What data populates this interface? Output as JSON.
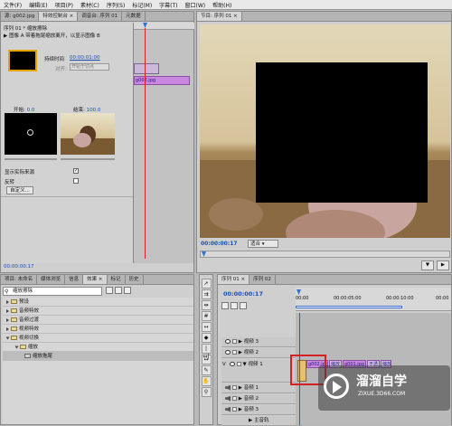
{
  "menubar": [
    "文件(F)",
    "编辑(E)",
    "项目(P)",
    "素材(C)",
    "序列(S)",
    "标记(M)",
    "字幕(T)",
    "窗口(W)",
    "帮助(H)"
  ],
  "effect_controls": {
    "tabs": [
      "源: g002.jpg",
      "特效控制台 ×",
      "调音台: 序列 01",
      "元数据"
    ],
    "sequence": "序列 01 * 缩放擦除",
    "clip": "g002.jpg",
    "description": "图像 A 带着拖尾缩放离开，以显示图像 B",
    "duration_label": "持续时间",
    "duration_value": "00:00:01:00",
    "alignment_label": "对齐:",
    "alignment_value": "开始于切点",
    "start_label": "开始:",
    "start_value": "0.0",
    "end_label": "结束:",
    "end_value": "100.0",
    "show_actual_label": "显示实际来源",
    "reverse_label": "反转",
    "custom_button": "自定义...",
    "timecode": "00:00:00:17"
  },
  "program": {
    "tab": "节目: 序列 01 ×",
    "timecode": "00:00:00:17",
    "fit_label": "适合"
  },
  "project_panel": {
    "tabs": [
      "项目: 未命名",
      "媒体浏览",
      "信息",
      "效果 ×",
      "标记",
      "历史"
    ],
    "search_value": "缩放擦除",
    "tree": [
      {
        "label": "预设",
        "indent": 0
      },
      {
        "label": "音频特效",
        "indent": 0
      },
      {
        "label": "音频过渡",
        "indent": 0
      },
      {
        "label": "视频特效",
        "indent": 0
      },
      {
        "label": "视频切换",
        "indent": 0,
        "open": true
      },
      {
        "label": "缩放",
        "indent": 1,
        "open": true
      },
      {
        "label": "缩放拖尾",
        "indent": 2,
        "selected": true
      }
    ]
  },
  "timeline": {
    "tabs": [
      "序列 01 ×",
      "序列 02"
    ],
    "timecode": "00:00:00:17",
    "ruler": [
      "00:00",
      "00:00:05:00",
      "00:00:10:00",
      "00:00"
    ],
    "tracks": [
      {
        "name": "视频 3",
        "type": "video"
      },
      {
        "name": "视频 2",
        "type": "video"
      },
      {
        "name": "视频 1",
        "type": "video",
        "tall": true
      },
      {
        "name": "音频 1",
        "type": "audio"
      },
      {
        "name": "音频 2",
        "type": "audio"
      },
      {
        "name": "音频 3",
        "type": "audio"
      },
      {
        "name": "主音轨",
        "type": "master"
      }
    ],
    "clips": [
      "g002.jpg",
      "缩放",
      "g001.jpg",
      "不透",
      "缩放"
    ]
  },
  "watermark": {
    "title": "溜溜自学",
    "subtitle": "ZIXUE.3D66.COM"
  }
}
